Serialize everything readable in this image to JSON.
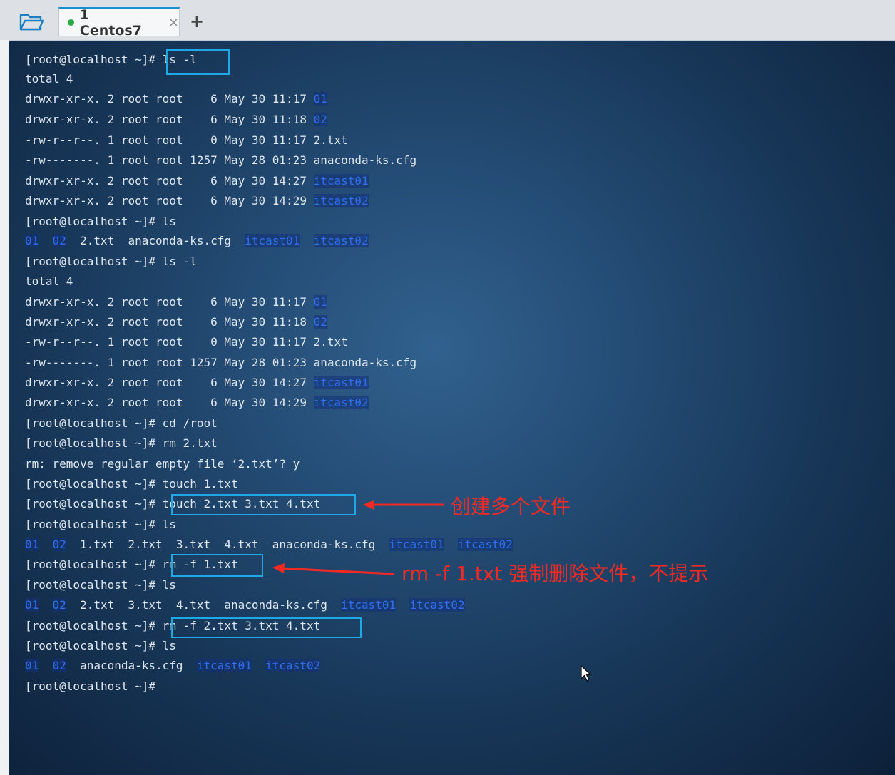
{
  "tabs": [
    {
      "label": "1 Centos7",
      "status_color": "#2aa745",
      "close_glyph": "×"
    }
  ],
  "add_tab_glyph": "+",
  "icons": {
    "open_folder": "folder-icon",
    "new_tab": "plus-icon",
    "mouse": "mouse-pointer-icon"
  },
  "colors": {
    "annotation": "#f22a22",
    "highlight_box": "#1fa8e6",
    "directory": "#2f6fe8"
  },
  "terminal": {
    "l1": {
      "prompt": "[root@localhost ~]# ",
      "cmd": "ls -l"
    },
    "l2": "total 4",
    "l3": {
      "pre": "drwxr-xr-x. 2 root root    6 May 30 11:17 ",
      "dir": "01"
    },
    "l4": {
      "pre": "drwxr-xr-x. 2 root root    6 May 30 11:18 ",
      "dir": "02"
    },
    "l5": "-rw-r--r--. 1 root root    0 May 30 11:17 2.txt",
    "l6": "-rw-------. 1 root root 1257 May 28 01:23 anaconda-ks.cfg",
    "l7": {
      "pre": "drwxr-xr-x. 2 root root    6 May 30 14:27 ",
      "dir": "itcast01"
    },
    "l8": {
      "pre": "drwxr-xr-x. 2 root root    6 May 30 14:29 ",
      "dir": "itcast02"
    },
    "l9": "[root@localhost ~]# ls",
    "l10": {
      "d1": "01",
      "d2": "02",
      "files": "2.txt  anaconda-ks.cfg",
      "d3": "itcast01",
      "d4": "itcast02"
    },
    "l11": "[root@localhost ~]# ls -l",
    "l12": "total 4",
    "l13": {
      "pre": "drwxr-xr-x. 2 root root    6 May 30 11:17 ",
      "dir": "01"
    },
    "l14": {
      "pre": "drwxr-xr-x. 2 root root    6 May 30 11:18 ",
      "dir": "02"
    },
    "l15": "-rw-r--r--. 1 root root    0 May 30 11:17 2.txt",
    "l16": "-rw-------. 1 root root 1257 May 28 01:23 anaconda-ks.cfg",
    "l17": {
      "pre": "drwxr-xr-x. 2 root root    6 May 30 14:27 ",
      "dir": "itcast01"
    },
    "l18": {
      "pre": "drwxr-xr-x. 2 root root    6 May 30 14:29 ",
      "dir": "itcast02"
    },
    "l19": "[root@localhost ~]# cd /root",
    "l20": "[root@localhost ~]# rm 2.txt",
    "l21": "rm: remove regular empty file ‘2.txt’? y",
    "l22": "[root@localhost ~]# touch 1.txt",
    "l23": {
      "prompt": "[root@localhost ~]# ",
      "cmd": "touch 2.txt 3.txt 4.txt"
    },
    "l24": "[root@localhost ~]# ls",
    "l25": {
      "d1": "01",
      "d2": "02",
      "files": "1.txt  2.txt  3.txt  4.txt  anaconda-ks.cfg",
      "d3": "itcast01",
      "d4": "itcast02"
    },
    "l26": {
      "prompt": "[root@localhost ~]# ",
      "cmd": "rm -f 1.txt"
    },
    "l27": "[root@localhost ~]# ls",
    "l28": {
      "d1": "01",
      "d2": "02",
      "files": "2.txt  3.txt  4.txt  anaconda-ks.cfg",
      "d3": "itcast01",
      "d4": "itcast02"
    },
    "l29": {
      "prompt": "[root@localhost ~]# ",
      "cmd": "rm -f 2.txt 3.txt 4.txt"
    },
    "l30": "[root@localhost ~]# ls",
    "l31": {
      "d1": "01",
      "d2": "02",
      "files": "anaconda-ks.cfg",
      "d3": "itcast01",
      "d4": "itcast02"
    },
    "l32": "[root@localhost ~]#"
  },
  "annotations": {
    "create_files": "创建多个文件",
    "force_delete": "rm -f 1.txt 强制删除文件，不提示"
  }
}
